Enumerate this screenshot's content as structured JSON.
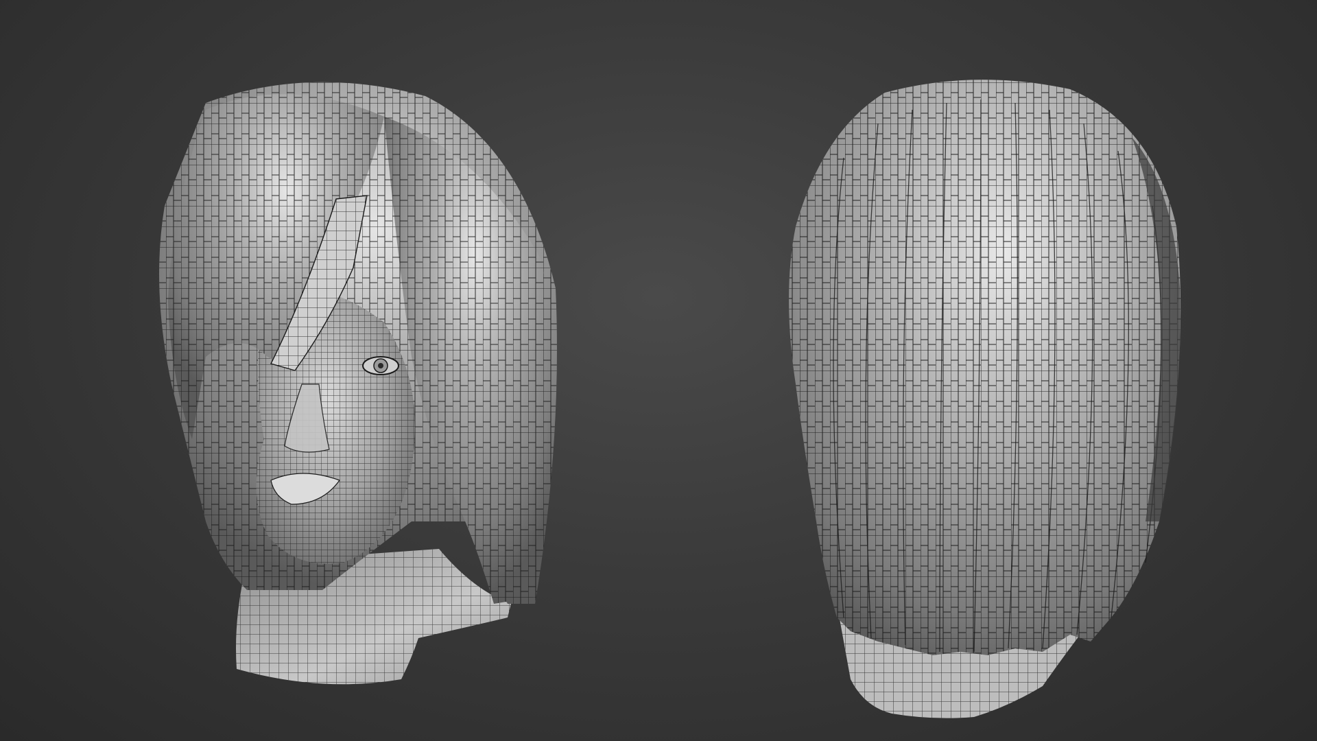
{
  "scene": {
    "viewport_background": "#3a3a3a",
    "mesh_color": "#a9a9a9",
    "wire_color": "#1a1a1a",
    "highlight_color": "#f2f2f2",
    "models": [
      {
        "name": "head-front-view",
        "view": "front-three-quarter"
      },
      {
        "name": "hair-back-view",
        "view": "back"
      }
    ]
  }
}
